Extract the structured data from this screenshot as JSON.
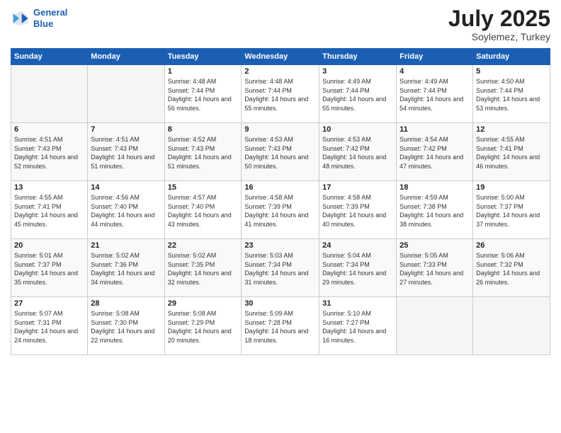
{
  "header": {
    "logo_line1": "General",
    "logo_line2": "Blue",
    "month": "July 2025",
    "location": "Soylemez, Turkey"
  },
  "days_of_week": [
    "Sunday",
    "Monday",
    "Tuesday",
    "Wednesday",
    "Thursday",
    "Friday",
    "Saturday"
  ],
  "weeks": [
    [
      {
        "day": "",
        "sunrise": "",
        "sunset": "",
        "daylight": ""
      },
      {
        "day": "",
        "sunrise": "",
        "sunset": "",
        "daylight": ""
      },
      {
        "day": "1",
        "sunrise": "Sunrise: 4:48 AM",
        "sunset": "Sunset: 7:44 PM",
        "daylight": "Daylight: 14 hours and 56 minutes."
      },
      {
        "day": "2",
        "sunrise": "Sunrise: 4:48 AM",
        "sunset": "Sunset: 7:44 PM",
        "daylight": "Daylight: 14 hours and 55 minutes."
      },
      {
        "day": "3",
        "sunrise": "Sunrise: 4:49 AM",
        "sunset": "Sunset: 7:44 PM",
        "daylight": "Daylight: 14 hours and 55 minutes."
      },
      {
        "day": "4",
        "sunrise": "Sunrise: 4:49 AM",
        "sunset": "Sunset: 7:44 PM",
        "daylight": "Daylight: 14 hours and 54 minutes."
      },
      {
        "day": "5",
        "sunrise": "Sunrise: 4:50 AM",
        "sunset": "Sunset: 7:44 PM",
        "daylight": "Daylight: 14 hours and 53 minutes."
      }
    ],
    [
      {
        "day": "6",
        "sunrise": "Sunrise: 4:51 AM",
        "sunset": "Sunset: 7:43 PM",
        "daylight": "Daylight: 14 hours and 52 minutes."
      },
      {
        "day": "7",
        "sunrise": "Sunrise: 4:51 AM",
        "sunset": "Sunset: 7:43 PM",
        "daylight": "Daylight: 14 hours and 51 minutes."
      },
      {
        "day": "8",
        "sunrise": "Sunrise: 4:52 AM",
        "sunset": "Sunset: 7:43 PM",
        "daylight": "Daylight: 14 hours and 51 minutes."
      },
      {
        "day": "9",
        "sunrise": "Sunrise: 4:53 AM",
        "sunset": "Sunset: 7:43 PM",
        "daylight": "Daylight: 14 hours and 50 minutes."
      },
      {
        "day": "10",
        "sunrise": "Sunrise: 4:53 AM",
        "sunset": "Sunset: 7:42 PM",
        "daylight": "Daylight: 14 hours and 48 minutes."
      },
      {
        "day": "11",
        "sunrise": "Sunrise: 4:54 AM",
        "sunset": "Sunset: 7:42 PM",
        "daylight": "Daylight: 14 hours and 47 minutes."
      },
      {
        "day": "12",
        "sunrise": "Sunrise: 4:55 AM",
        "sunset": "Sunset: 7:41 PM",
        "daylight": "Daylight: 14 hours and 46 minutes."
      }
    ],
    [
      {
        "day": "13",
        "sunrise": "Sunrise: 4:55 AM",
        "sunset": "Sunset: 7:41 PM",
        "daylight": "Daylight: 14 hours and 45 minutes."
      },
      {
        "day": "14",
        "sunrise": "Sunrise: 4:56 AM",
        "sunset": "Sunset: 7:40 PM",
        "daylight": "Daylight: 14 hours and 44 minutes."
      },
      {
        "day": "15",
        "sunrise": "Sunrise: 4:57 AM",
        "sunset": "Sunset: 7:40 PM",
        "daylight": "Daylight: 14 hours and 43 minutes."
      },
      {
        "day": "16",
        "sunrise": "Sunrise: 4:58 AM",
        "sunset": "Sunset: 7:39 PM",
        "daylight": "Daylight: 14 hours and 41 minutes."
      },
      {
        "day": "17",
        "sunrise": "Sunrise: 4:58 AM",
        "sunset": "Sunset: 7:39 PM",
        "daylight": "Daylight: 14 hours and 40 minutes."
      },
      {
        "day": "18",
        "sunrise": "Sunrise: 4:59 AM",
        "sunset": "Sunset: 7:38 PM",
        "daylight": "Daylight: 14 hours and 38 minutes."
      },
      {
        "day": "19",
        "sunrise": "Sunrise: 5:00 AM",
        "sunset": "Sunset: 7:37 PM",
        "daylight": "Daylight: 14 hours and 37 minutes."
      }
    ],
    [
      {
        "day": "20",
        "sunrise": "Sunrise: 5:01 AM",
        "sunset": "Sunset: 7:37 PM",
        "daylight": "Daylight: 14 hours and 35 minutes."
      },
      {
        "day": "21",
        "sunrise": "Sunrise: 5:02 AM",
        "sunset": "Sunset: 7:36 PM",
        "daylight": "Daylight: 14 hours and 34 minutes."
      },
      {
        "day": "22",
        "sunrise": "Sunrise: 5:02 AM",
        "sunset": "Sunset: 7:35 PM",
        "daylight": "Daylight: 14 hours and 32 minutes."
      },
      {
        "day": "23",
        "sunrise": "Sunrise: 5:03 AM",
        "sunset": "Sunset: 7:34 PM",
        "daylight": "Daylight: 14 hours and 31 minutes."
      },
      {
        "day": "24",
        "sunrise": "Sunrise: 5:04 AM",
        "sunset": "Sunset: 7:34 PM",
        "daylight": "Daylight: 14 hours and 29 minutes."
      },
      {
        "day": "25",
        "sunrise": "Sunrise: 5:05 AM",
        "sunset": "Sunset: 7:33 PM",
        "daylight": "Daylight: 14 hours and 27 minutes."
      },
      {
        "day": "26",
        "sunrise": "Sunrise: 5:06 AM",
        "sunset": "Sunset: 7:32 PM",
        "daylight": "Daylight: 14 hours and 26 minutes."
      }
    ],
    [
      {
        "day": "27",
        "sunrise": "Sunrise: 5:07 AM",
        "sunset": "Sunset: 7:31 PM",
        "daylight": "Daylight: 14 hours and 24 minutes."
      },
      {
        "day": "28",
        "sunrise": "Sunrise: 5:08 AM",
        "sunset": "Sunset: 7:30 PM",
        "daylight": "Daylight: 14 hours and 22 minutes."
      },
      {
        "day": "29",
        "sunrise": "Sunrise: 5:08 AM",
        "sunset": "Sunset: 7:29 PM",
        "daylight": "Daylight: 14 hours and 20 minutes."
      },
      {
        "day": "30",
        "sunrise": "Sunrise: 5:09 AM",
        "sunset": "Sunset: 7:28 PM",
        "daylight": "Daylight: 14 hours and 18 minutes."
      },
      {
        "day": "31",
        "sunrise": "Sunrise: 5:10 AM",
        "sunset": "Sunset: 7:27 PM",
        "daylight": "Daylight: 14 hours and 16 minutes."
      },
      {
        "day": "",
        "sunrise": "",
        "sunset": "",
        "daylight": ""
      },
      {
        "day": "",
        "sunrise": "",
        "sunset": "",
        "daylight": ""
      }
    ]
  ]
}
